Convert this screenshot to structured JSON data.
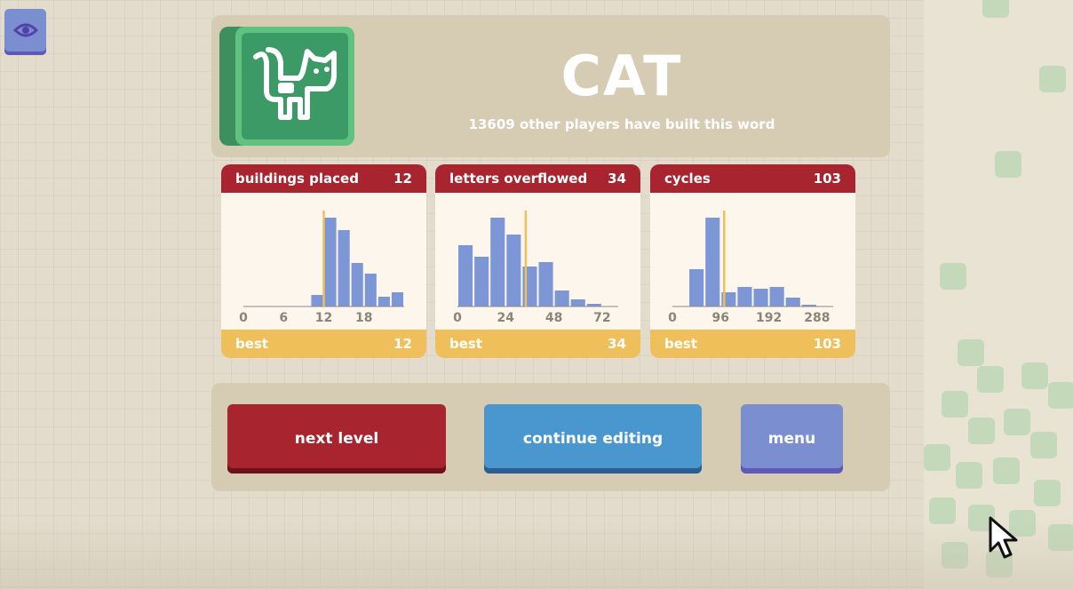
{
  "header": {
    "word": "CAT",
    "players_text": "13609 other players have built this word"
  },
  "stats": [
    {
      "label": "buildings placed",
      "value": "12",
      "best_label": "best",
      "best_value": "12"
    },
    {
      "label": "letters overflowed",
      "value": "34",
      "best_label": "best",
      "best_value": "34"
    },
    {
      "label": "cycles",
      "value": "103",
      "best_label": "best",
      "best_value": "103"
    }
  ],
  "chart_data": [
    {
      "type": "bar",
      "title": "buildings placed",
      "x_ticks": [
        "0",
        "6",
        "12",
        "18"
      ],
      "x_range": [
        0,
        24
      ],
      "bin_width": 2,
      "bins_start": 0,
      "values": [
        0,
        0,
        0,
        0,
        0,
        0.13,
        1.0,
        0.86,
        0.49,
        0.37,
        0.11,
        0.16
      ],
      "marker_x": 12,
      "bar_color": "#7d96d6",
      "marker_color": "#efbf5c"
    },
    {
      "type": "bar",
      "title": "letters overflowed",
      "x_ticks": [
        "0",
        "24",
        "48",
        "72"
      ],
      "x_range": [
        0,
        80
      ],
      "bin_width": 8,
      "bins_start": 0,
      "values": [
        0.69,
        0.56,
        1.0,
        0.81,
        0.45,
        0.5,
        0.18,
        0.08,
        0.03,
        0.0
      ],
      "marker_x": 34,
      "bar_color": "#7d96d6",
      "marker_color": "#efbf5c"
    },
    {
      "type": "bar",
      "title": "cycles",
      "x_ticks": [
        "0",
        "96",
        "192",
        "288"
      ],
      "x_range": [
        0,
        320
      ],
      "bin_width": 32,
      "bins_start": 0,
      "values": [
        0,
        0.42,
        1.0,
        0.16,
        0.22,
        0.2,
        0.22,
        0.1,
        0.02,
        0
      ],
      "marker_x": 103,
      "bar_color": "#7d96d6",
      "marker_color": "#efbf5c"
    }
  ],
  "buttons": {
    "next_level": "next level",
    "continue_editing": "continue editing",
    "menu": "menu"
  },
  "colors": {
    "card_header": "#a8242f",
    "card_footer": "#efbf5c",
    "button_next": "#a8242f",
    "button_continue": "#4a97d0",
    "button_menu": "#7b8ed0",
    "logo_green": "#3c9a67"
  },
  "icons": {
    "toggle": "eye-icon",
    "logo": "cat-glyph-icon",
    "pointer": "mouse-cursor-icon"
  }
}
